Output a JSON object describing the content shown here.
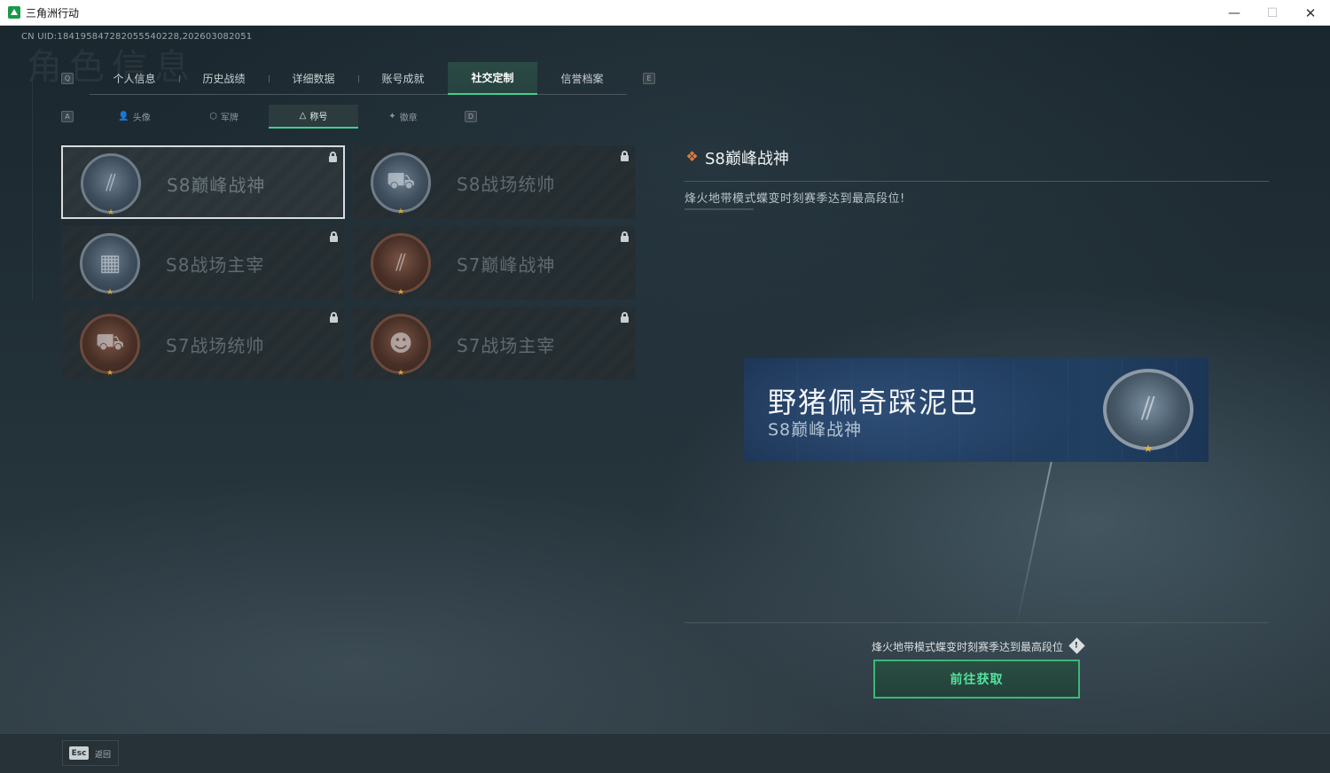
{
  "window": {
    "title": "三角洲行动",
    "minimize_glyph": "—",
    "maximize_glyph": "☐",
    "close_glyph": "✕"
  },
  "header": {
    "uid": "CN UID:1841958472820555402​28,202603082051",
    "bg_heading": "角色信息"
  },
  "tabs": {
    "prev_key": "Q",
    "next_key": "E",
    "items": [
      {
        "label": "个人信息"
      },
      {
        "label": "历史战绩"
      },
      {
        "label": "详细数据"
      },
      {
        "label": "账号成就"
      },
      {
        "label": "社交定制",
        "active": true
      },
      {
        "label": "信誉档案"
      }
    ]
  },
  "subtabs": {
    "prev_key": "A",
    "next_key": "D",
    "items": [
      {
        "label": "头像",
        "icon": "person-icon"
      },
      {
        "label": "军牌",
        "icon": "dogtag-icon"
      },
      {
        "label": "称号",
        "icon": "title-icon",
        "active": true
      },
      {
        "label": "徽章",
        "icon": "badge-icon"
      }
    ]
  },
  "titles": [
    {
      "name": "S8巅峰战神",
      "emblem": "blue",
      "locked": true,
      "selected": true
    },
    {
      "name": "S8战场统帅",
      "emblem": "blue",
      "locked": true
    },
    {
      "name": "S8战场主宰",
      "emblem": "blue",
      "locked": true
    },
    {
      "name": "S7巅峰战神",
      "emblem": "copper",
      "locked": true
    },
    {
      "name": "S7战场统帅",
      "emblem": "copper",
      "locked": true
    },
    {
      "name": "S7战场主宰",
      "emblem": "copper",
      "locked": true
    }
  ],
  "detail": {
    "title": "S8巅峰战神",
    "description": "烽火地带模式蝶变时刻赛季达到最高段位!",
    "plate_player": "野猪佩奇踩泥巴",
    "plate_title": "S8巅峰战神",
    "requirement": "烽火地带模式蝶变时刻赛季达到最高段位",
    "goto_button": "前往获取"
  },
  "footer": {
    "esc_key": "Esc",
    "back_label": "返回"
  },
  "colors": {
    "accent": "#3ed08d",
    "button_text": "#56e39c",
    "title_icon": "#e07a3a"
  }
}
